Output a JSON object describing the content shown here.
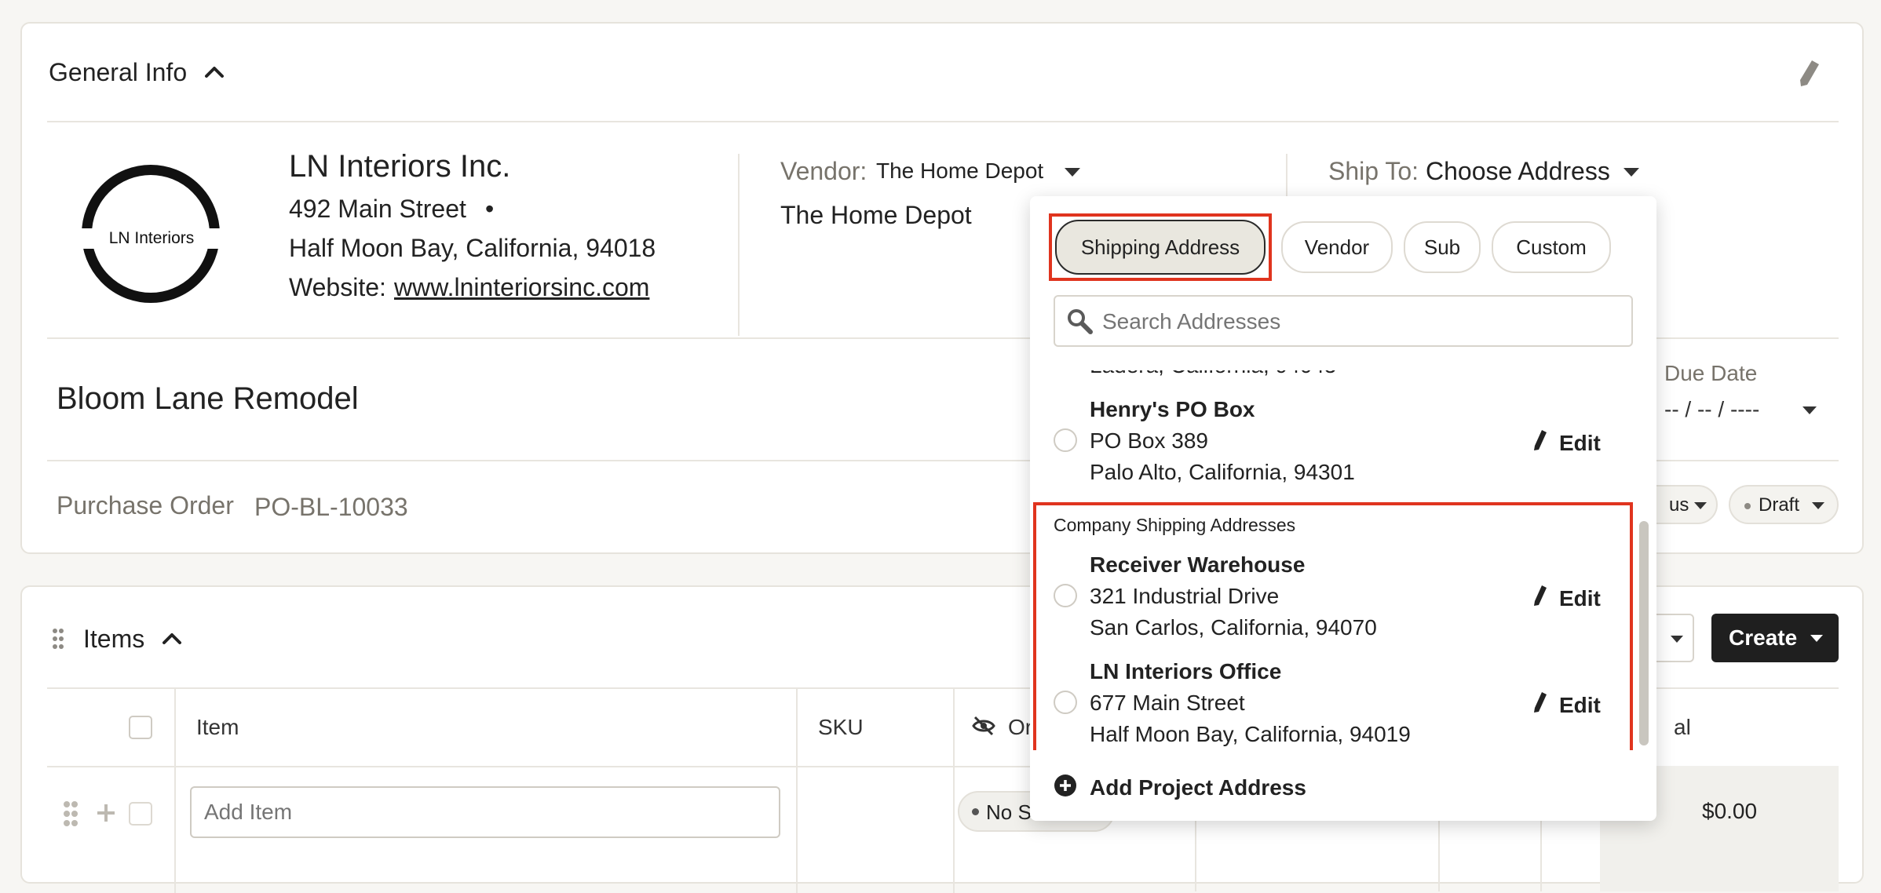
{
  "general_info": {
    "title": "General Info",
    "logo_text": "LN Interiors",
    "company": {
      "name": "LN Interiors Inc.",
      "street": "492 Main Street",
      "bullet": "•",
      "city_line": "Half Moon Bay, California, 94018",
      "website_label": "Website:",
      "website": "www.lninteriorsinc.com"
    },
    "vendor": {
      "label": "Vendor:",
      "value": "The Home Depot",
      "name_line": "The Home Depot"
    },
    "ship_to": {
      "label": "Ship To:",
      "value": "Choose Address"
    },
    "project_name": "Bloom Lane Remodel",
    "due_date": {
      "label": "Due Date",
      "placeholder": "-- / -- / ----"
    },
    "purchase_order": {
      "label": "Purchase Order",
      "value": "PO-BL-10033"
    },
    "status_partial": "us",
    "draft_label": "Draft"
  },
  "items": {
    "title": "Items",
    "create_label": "Create",
    "columns": {
      "item": "Item",
      "sku": "SKU",
      "order_partial": "Or",
      "total_partial": "al"
    },
    "add_item_placeholder": "Add Item",
    "status_partial": "No St",
    "amount": "$0.00"
  },
  "dropdown": {
    "tabs": [
      "Shipping Address",
      "Vendor",
      "Sub",
      "Custom"
    ],
    "active_tab": "Shipping Address",
    "search_placeholder": "Search Addresses",
    "clipped_line": "Ladera, California, 94045",
    "edit_label": "Edit",
    "project_addresses": [
      {
        "name": "Henry's PO Box",
        "street": "PO Box 389",
        "city": "Palo Alto, California, 94301"
      }
    ],
    "company_section_title": "Company Shipping Addresses",
    "company_addresses": [
      {
        "name": "Receiver Warehouse",
        "street": "321 Industrial Drive",
        "city": "San Carlos, California, 94070"
      },
      {
        "name": "LN Interiors Office",
        "street": "677 Main Street",
        "city": "Half Moon Bay, California, 94019"
      }
    ],
    "add_project_address": "Add Project Address"
  },
  "colors": {
    "highlight": "#e0341e",
    "active_tab_bg": "#e9e7df",
    "muted_text": "#77736b",
    "dark_button": "#1f1f1f"
  }
}
